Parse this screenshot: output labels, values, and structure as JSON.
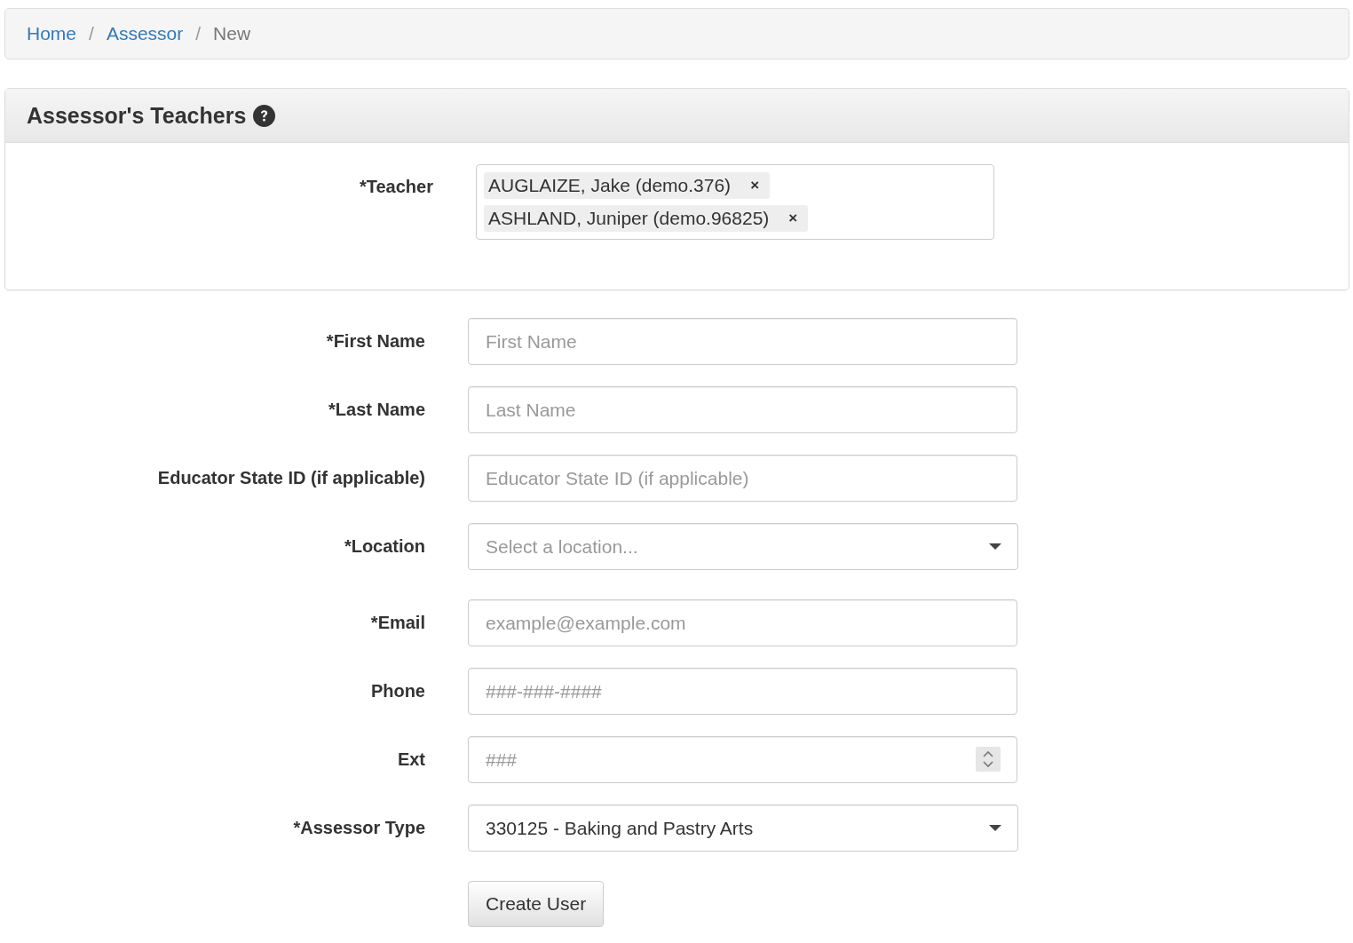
{
  "breadcrumb": [
    {
      "label": "Home",
      "kind": "link"
    },
    {
      "label": "Assessor",
      "kind": "link"
    },
    {
      "label": "New",
      "kind": "current"
    }
  ],
  "breadcrumb_separator": "/",
  "panel": {
    "title": "Assessor's Teachers",
    "teacher": {
      "label": "*Teacher",
      "tags": [
        {
          "text": "AUGLAIZE, Jake (demo.376)",
          "remove": "×"
        },
        {
          "text": "ASHLAND, Juniper (demo.96825)",
          "remove": "×"
        }
      ]
    }
  },
  "fields": [
    {
      "label": "*First Name",
      "kind": "text",
      "placeholder": "First Name"
    },
    {
      "label": "*Last Name",
      "kind": "text",
      "placeholder": "Last Name"
    },
    {
      "label": "Educator State ID (if applicable)",
      "kind": "text",
      "placeholder": "Educator State ID (if applicable)"
    },
    {
      "label": "*Location",
      "kind": "select",
      "placeholder": "Select a location..."
    },
    {
      "label": "*Email",
      "kind": "text",
      "placeholder": "example@example.com"
    },
    {
      "label": "Phone",
      "kind": "text",
      "placeholder": "###-###-####"
    },
    {
      "label": "Ext",
      "kind": "number",
      "placeholder": "###"
    },
    {
      "label": "*Assessor Type",
      "kind": "select",
      "value": "330125 - Baking and Pastry Arts"
    }
  ],
  "submit": "Create User"
}
